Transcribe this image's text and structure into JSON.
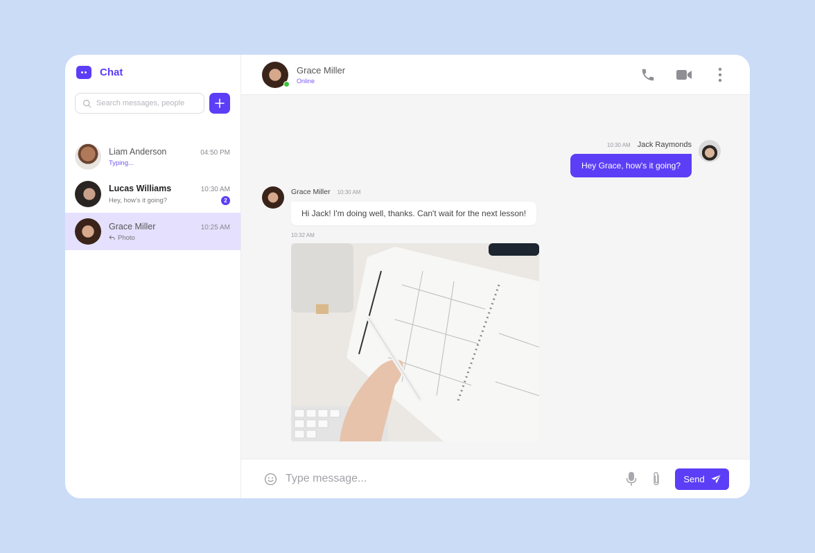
{
  "app": {
    "name": "Chat"
  },
  "sidebar": {
    "search_placeholder": "Search messages, people",
    "add_button_label": "+",
    "conversations": [
      {
        "name": "Liam Anderson",
        "time": "04:50 PM",
        "preview": "Typing...",
        "typing": true,
        "unread": null,
        "active": false
      },
      {
        "name": "Lucas Williams",
        "time": "10:30 AM",
        "preview": "Hey, how's it going?",
        "typing": false,
        "unread": "2",
        "active": false
      },
      {
        "name": "Grace Miller",
        "time": "10:25 AM",
        "preview": "Photo",
        "typing": false,
        "unread": null,
        "active": true,
        "preview_icon": "reply-icon"
      }
    ]
  },
  "chat": {
    "contact_name": "Grace Miller",
    "contact_status": "Online",
    "actions": [
      "phone-icon",
      "video-icon",
      "more-vertical-icon"
    ],
    "messages": [
      {
        "author": "Jack Raymonds",
        "time": "10:30 AM",
        "text": "Hey Grace, how's it going?",
        "direction": "outgoing"
      },
      {
        "author": "Grace Miller",
        "time": "10:30 AM",
        "text": "Hi Jack! I'm doing well, thanks. Can't wait for the next lesson!",
        "direction": "incoming"
      },
      {
        "author": "Grace Miller",
        "time": "10:32 AM",
        "attachment": "photo-planner-desk",
        "direction": "incoming"
      }
    ]
  },
  "composer": {
    "placeholder": "Type message...",
    "send_label": "Send"
  },
  "colors": {
    "accent": "#5b3ef6",
    "active_row": "#e4e0fd",
    "online": "#3dc43d",
    "page_bg": "#cbdcf7"
  }
}
